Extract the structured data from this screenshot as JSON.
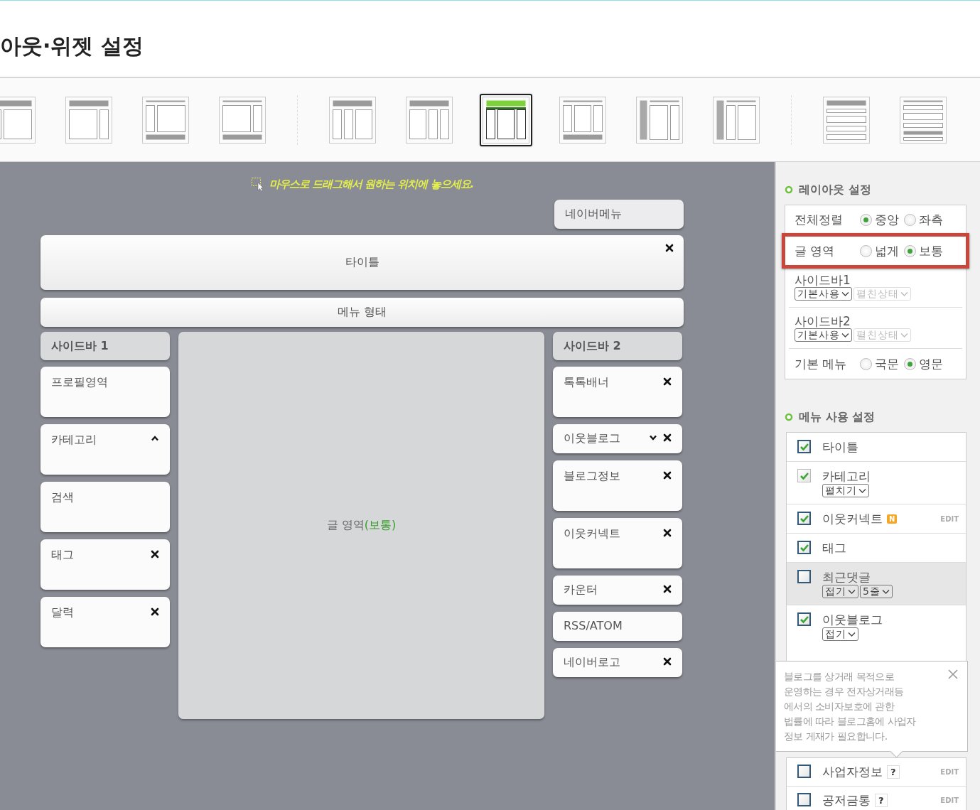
{
  "page_title": "아웃·위젯 설정",
  "layout_groups": [
    {
      "layouts": [
        {
          "kind": "header-left-main",
          "selected": false
        },
        {
          "kind": "header-main-right",
          "selected": false
        },
        {
          "kind": "left-main-footer",
          "selected": false
        },
        {
          "kind": "main-right-footer",
          "selected": false
        }
      ]
    },
    {
      "layouts": [
        {
          "kind": "header-left-left-main",
          "selected": false
        },
        {
          "kind": "header-main-right-right",
          "selected": false
        },
        {
          "kind": "header-three",
          "selected": true
        },
        {
          "kind": "three-footer",
          "selected": false
        },
        {
          "kind": "side-main-right",
          "selected": false
        },
        {
          "kind": "side-left-main",
          "selected": false
        }
      ]
    },
    {
      "layouts": [
        {
          "kind": "rows",
          "selected": false
        },
        {
          "kind": "rows-footer",
          "selected": false
        }
      ]
    }
  ],
  "canvas": {
    "hint": "마우스로 드래그해서 원하는 위치에 놓으세요.",
    "top_widget": {
      "label": "네이버메뉴"
    },
    "title_bar": {
      "label": "타이틀",
      "closable": true
    },
    "menu_bar": {
      "label": "메뉴 형태"
    },
    "sidebar1": {
      "title": "사이드바 1",
      "widgets": [
        {
          "label": "프로필영역",
          "kind": "tall",
          "closable": false
        },
        {
          "label": "카테고리",
          "kind": "tall",
          "closable": false,
          "expanded": true
        },
        {
          "label": "검색",
          "kind": "tall",
          "closable": false
        },
        {
          "label": "태그",
          "kind": "tall",
          "closable": true
        },
        {
          "label": "달력",
          "kind": "tall",
          "closable": true
        }
      ]
    },
    "content": {
      "label": "글 영역",
      "mode": "(보통)"
    },
    "sidebar2": {
      "title": "사이드바 2",
      "widgets": [
        {
          "label": "톡톡배너",
          "kind": "tall",
          "closable": true
        },
        {
          "label": "이웃블로그",
          "kind": "short",
          "closable": true,
          "expanded": false
        },
        {
          "label": "블로그정보",
          "kind": "tall",
          "closable": true
        },
        {
          "label": "이웃커넥트",
          "kind": "tall",
          "closable": true
        },
        {
          "label": "카운터",
          "kind": "short",
          "closable": true
        },
        {
          "label": "RSS/ATOM",
          "kind": "short",
          "closable": false
        },
        {
          "label": "네이버로고",
          "kind": "short",
          "closable": true
        }
      ]
    }
  },
  "layout_settings": {
    "title": "레이아웃 설정",
    "rows": [
      {
        "kind": "radio",
        "label": "전체정렬",
        "highlighted": false,
        "options": [
          {
            "label": "중앙",
            "selected": true
          },
          {
            "label": "좌측",
            "selected": false
          }
        ]
      },
      {
        "kind": "radio",
        "label": "글 영역",
        "highlighted": true,
        "options": [
          {
            "label": "넓게",
            "selected": false
          },
          {
            "label": "보통",
            "selected": true
          }
        ]
      },
      {
        "kind": "selects",
        "label": "사이드바1",
        "highlighted": false,
        "selects": [
          {
            "value": "기본사용",
            "disabled": false
          },
          {
            "value": "펼친상태",
            "disabled": true
          }
        ]
      },
      {
        "kind": "selects",
        "label": "사이드바2",
        "highlighted": false,
        "selects": [
          {
            "value": "기본사용",
            "disabled": false
          },
          {
            "value": "펼친상태",
            "disabled": true
          }
        ]
      },
      {
        "kind": "radio",
        "label": "기본 메뉴",
        "highlighted": false,
        "options": [
          {
            "label": "국문",
            "selected": false
          },
          {
            "label": "영문",
            "selected": true
          }
        ]
      }
    ]
  },
  "menu_settings": {
    "title": "메뉴 사용 설정",
    "items": [
      {
        "label": "타이틀",
        "checked": true,
        "disabled": false,
        "highlighted": false
      },
      {
        "label": "카테고리",
        "checked": true,
        "disabled": true,
        "highlighted": false,
        "selects": [
          {
            "value": "펼치기",
            "disabled": false
          }
        ]
      },
      {
        "label": "이웃커넥트",
        "checked": true,
        "disabled": false,
        "highlighted": false,
        "badge": "N",
        "edit": "EDIT"
      },
      {
        "label": "태그",
        "checked": true,
        "disabled": false,
        "highlighted": false
      },
      {
        "label": "최근댓글",
        "checked": false,
        "disabled": false,
        "highlighted": true,
        "selects": [
          {
            "value": "접기",
            "disabled": false
          },
          {
            "value": "5줄",
            "disabled": false
          }
        ]
      },
      {
        "label": "이웃블로그",
        "checked": true,
        "disabled": false,
        "highlighted": false,
        "selects": [
          {
            "value": "접기",
            "disabled": false
          }
        ]
      }
    ],
    "more_items": [
      {
        "label": "사업자정보",
        "checked": false,
        "disabled": false,
        "highlighted": false,
        "help": "?",
        "edit": "EDIT"
      },
      {
        "label": "공저금통",
        "checked": false,
        "disabled": false,
        "highlighted": false,
        "help": "?",
        "edit": "EDIT"
      }
    ]
  },
  "tooltip": {
    "text": "블로그를 상거래 목적으로\n운영하는 경우 전자상거래등\n에서의 소비자보호에 관한\n법률에 따라 블로그홈에 사업자\n정보 게재가 필요합니다."
  }
}
